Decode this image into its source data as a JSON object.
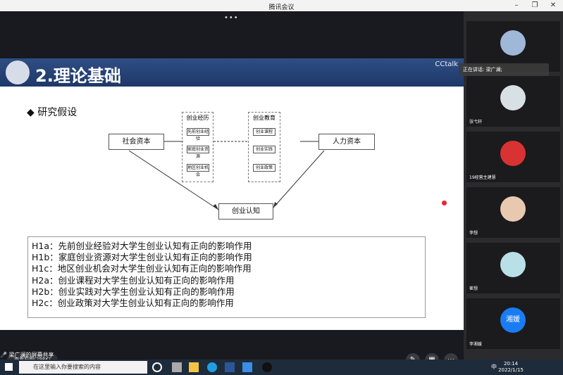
{
  "window": {
    "title": "腾讯会议"
  },
  "top": {
    "dots": "•••"
  },
  "slide": {
    "title": "2.理论基础",
    "brand": "CCtalk",
    "heading": "◆ 研究假设",
    "diagram": {
      "social_capital": "社会资本",
      "human_capital": "人力资本",
      "outcome": "创业认知",
      "exp_group": "创业经历",
      "edu_group": "创业教育",
      "exp_items": [
        "先前创业经验",
        "家庭创业资源",
        "地区创业机会"
      ],
      "edu_items": [
        "创业课程",
        "创业实践",
        "创业政策"
      ]
    },
    "hypotheses": [
      "H1a：先前创业经验对大学生创业认知有正向的影响作用",
      "H1b：家庭创业资源对大学生创业认知有正向的影响作用",
      "H1c：地区创业机会对大学生创业认知有正向的影响作用",
      "H2a：创业课程对大学生创业认知有正向的影响作用",
      "H2b：创业实践对大学生创业认知有正向的影响作用",
      "H2c：创业政策对大学生创业认知有正向的影响作用"
    ]
  },
  "speaker": {
    "label": "正在讲话: 梁广澜;"
  },
  "participants": [
    {
      "name": "",
      "color": "#9fb8d8"
    },
    {
      "name": "张弋轩",
      "color": "#d8e0e6"
    },
    {
      "name": "19经营主建慧",
      "color": "#d93232"
    },
    {
      "name": "李想",
      "color": "#e8c9b0"
    },
    {
      "name": "崔想",
      "color": "#b9e0e6"
    },
    {
      "name": "李湘媛",
      "color": "#1a7cf2",
      "avatar_text": "湘媛"
    }
  ],
  "controls": {
    "view_original": "查看原图(298K)",
    "share_label": "梁广澜的屏幕共享"
  },
  "taskbar": {
    "search_placeholder": "在这里输入你要搜索的内容",
    "time": "20:14",
    "date": "2022/1/15",
    "ime": "中"
  }
}
